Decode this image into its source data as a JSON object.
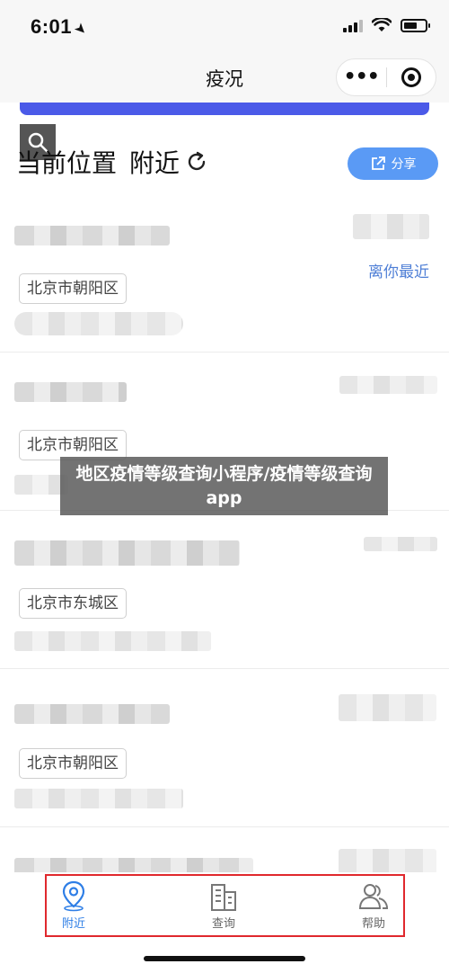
{
  "status_bar": {
    "time": "6:01"
  },
  "nav": {
    "title": "疫况",
    "more_label": "•••"
  },
  "header": {
    "location_label": "当前位置",
    "nearby_label": "附近",
    "share_label": "分享"
  },
  "cards": [
    {
      "district": "北京市朝阳区",
      "nearest_label": "离你最近"
    },
    {
      "district": "北京市朝阳区"
    },
    {
      "district": "北京市东城区"
    },
    {
      "district": "北京市朝阳区"
    }
  ],
  "watermark": {
    "text": "地区疫情等级查询小程序/疫情等级查询app"
  },
  "tabbar": {
    "tabs": [
      {
        "label": "附近",
        "icon": "location-pin-icon",
        "active": true
      },
      {
        "label": "查询",
        "icon": "building-icon",
        "active": false
      },
      {
        "label": "帮助",
        "icon": "people-icon",
        "active": false
      }
    ]
  },
  "colors": {
    "accent_blue": "#4b5ae8",
    "share_blue": "#5a9af5",
    "active_tab": "#2e7ee6",
    "highlight_red": "#e0282d"
  }
}
